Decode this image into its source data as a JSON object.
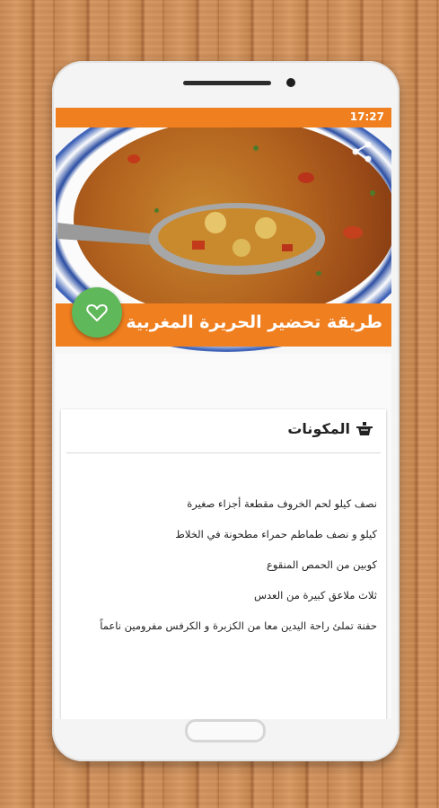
{
  "status_bar": {
    "time": "17:27"
  },
  "recipe": {
    "title": "طريقة تحضير الحريرة المغربية",
    "favorite_icon": "heart-icon",
    "share_icon": "share-icon"
  },
  "ingredients_card": {
    "heading": "المكونات",
    "heading_icon": "pot-icon",
    "items": [
      "نصف كيلو لحم الخروف مقطعة أجزاء صغيرة",
      "كيلو و نصف طماطم حمراء مطحونة في الخلاط",
      "كوبين من الحمص المنقوع",
      "ثلاث ملاعق كبيرة من العدس",
      "حفنة تملئ راحة اليدين معا من الكزبرة و الكرفس مفرومين ناعماً"
    ]
  },
  "colors": {
    "accent": "#f07f1f",
    "fab": "#5fb85a"
  }
}
